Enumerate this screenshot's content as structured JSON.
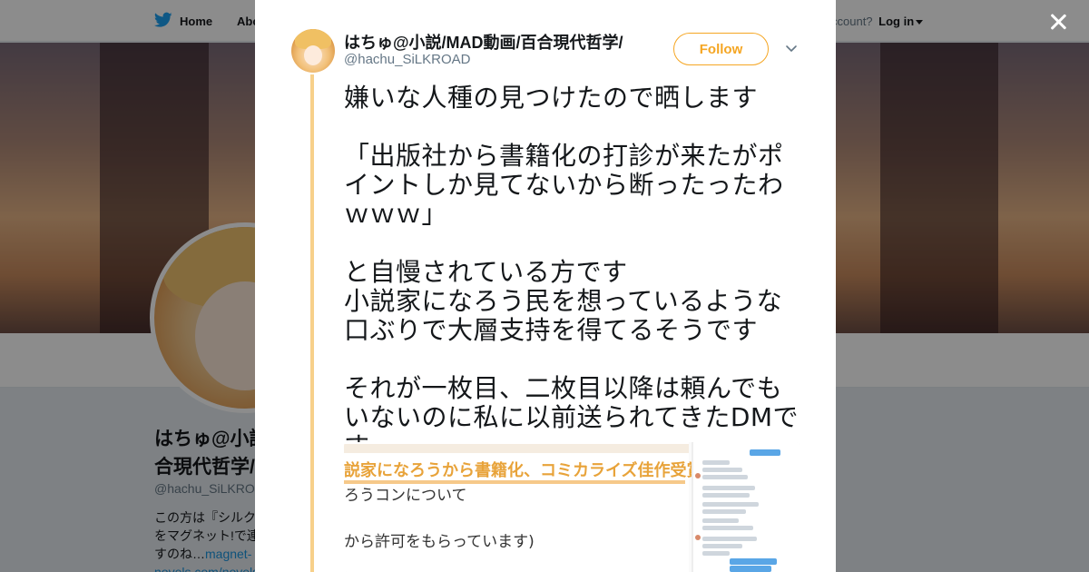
{
  "nav": {
    "home_label": "Home",
    "about_label": "Abo",
    "account_prefix": "ccount?",
    "login_label": "Log in"
  },
  "profile": {
    "name_line1": "はちゅ@小説/",
    "name_line2": "合現代哲学/",
    "handle": "@hachu_SiLKRO",
    "bio_line1": "この方は『シルク",
    "bio_line2": "をマグネット!で連",
    "bio_line3_text": "すのね…",
    "bio_line3_link": "magnet-",
    "bio_line4_link": "novels.com/novels"
  },
  "tweet": {
    "author_name": "はちゅ@小説/MAD動画/百合現代哲学/",
    "author_handle": "@hachu_SiLKROAD",
    "follow_label": "Follow",
    "text_paragraphs": [
      "嫌いな人種の見つけたので晒します",
      "「出版社から書籍化の打診が来たがポイントしか見てないから断ったったわｗｗｗ」",
      "と自慢されている方です\n小説家になろう民を想っているような口ぶりで大層支持を得てるそうです",
      "それが一枚目、二枚目以降は頼んでもいないのに私に以前送られてきたDMです"
    ],
    "media": {
      "headline": "説家になろうから書籍化、コミカライズ佳作受賞",
      "line1": "ろうコンについて",
      "line2": "から許可をもらっています)"
    }
  },
  "colors": {
    "accent": "#f5a623",
    "link": "#1b95e0",
    "thread": "#f7d08a"
  },
  "icons": {
    "bird": "twitter-bird-icon",
    "close": "close-icon",
    "chevron": "chevron-down-icon"
  }
}
